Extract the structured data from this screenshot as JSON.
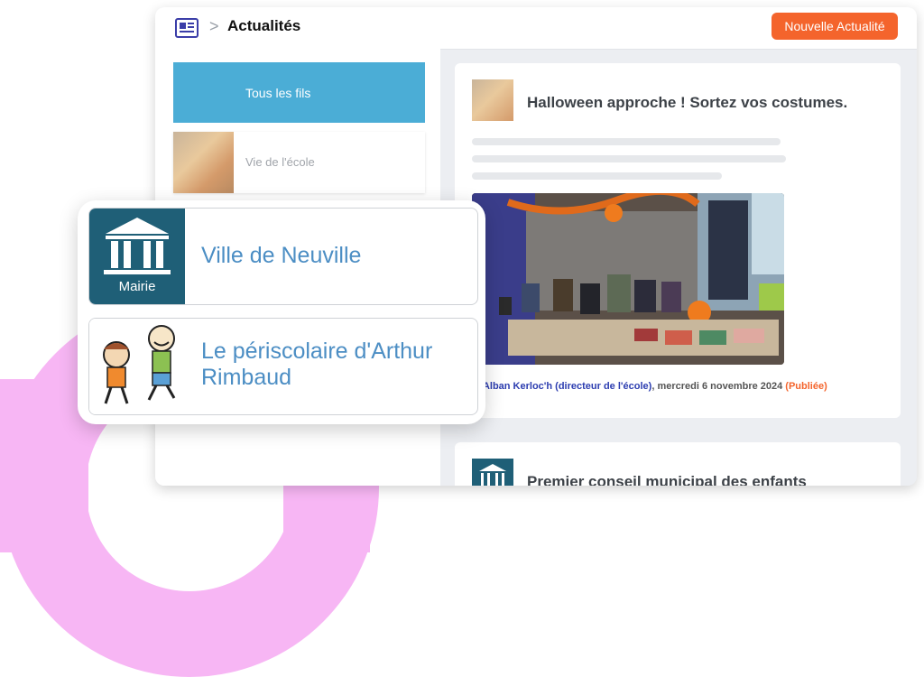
{
  "header": {
    "icon": "newspaper-icon",
    "separator": ">",
    "title": "Actualités",
    "new_button": "Nouvelle Actualité"
  },
  "sidebar": {
    "active_item": "Tous les fils",
    "items": [
      {
        "label": "Vie de l'école",
        "thumb": "classroom-thumbnail"
      }
    ]
  },
  "posts": [
    {
      "title": "Halloween approche ! Sortez vos costumes.",
      "byline_prefix": "r ",
      "author": "Alban Kerloc'h (directeur de l'école)",
      "date": ", mercredi 6 novembre 2024 ",
      "status": "(Publiée)"
    },
    {
      "title": "Premier conseil municipal des enfants"
    }
  ],
  "popover": {
    "items": [
      {
        "logo_text": "Mairie",
        "name": "Ville de Neuville"
      },
      {
        "name": "Le périscolaire d'Arthur Rimbaud"
      }
    ]
  },
  "colors": {
    "accent_orange": "#f4642c",
    "sidebar_active": "#4badd6",
    "mairie_blue": "#1f5f77",
    "link_blue": "#4c8ec4",
    "pink": "#f7b6f4"
  }
}
